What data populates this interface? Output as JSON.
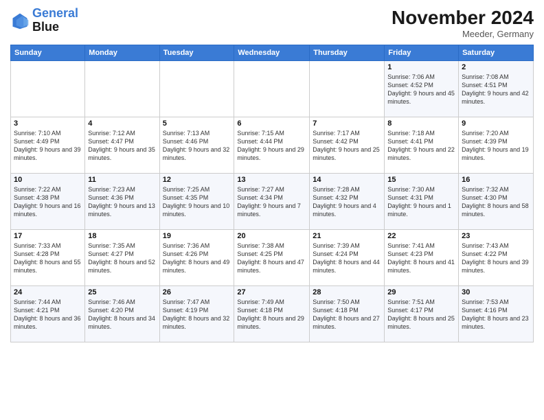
{
  "logo": {
    "line1": "General",
    "line2": "Blue"
  },
  "title": "November 2024",
  "location": "Meeder, Germany",
  "days_header": [
    "Sunday",
    "Monday",
    "Tuesday",
    "Wednesday",
    "Thursday",
    "Friday",
    "Saturday"
  ],
  "weeks": [
    [
      {
        "day": "",
        "sunrise": "",
        "sunset": "",
        "daylight": ""
      },
      {
        "day": "",
        "sunrise": "",
        "sunset": "",
        "daylight": ""
      },
      {
        "day": "",
        "sunrise": "",
        "sunset": "",
        "daylight": ""
      },
      {
        "day": "",
        "sunrise": "",
        "sunset": "",
        "daylight": ""
      },
      {
        "day": "",
        "sunrise": "",
        "sunset": "",
        "daylight": ""
      },
      {
        "day": "1",
        "sunrise": "Sunrise: 7:06 AM",
        "sunset": "Sunset: 4:52 PM",
        "daylight": "Daylight: 9 hours and 45 minutes."
      },
      {
        "day": "2",
        "sunrise": "Sunrise: 7:08 AM",
        "sunset": "Sunset: 4:51 PM",
        "daylight": "Daylight: 9 hours and 42 minutes."
      }
    ],
    [
      {
        "day": "3",
        "sunrise": "Sunrise: 7:10 AM",
        "sunset": "Sunset: 4:49 PM",
        "daylight": "Daylight: 9 hours and 39 minutes."
      },
      {
        "day": "4",
        "sunrise": "Sunrise: 7:12 AM",
        "sunset": "Sunset: 4:47 PM",
        "daylight": "Daylight: 9 hours and 35 minutes."
      },
      {
        "day": "5",
        "sunrise": "Sunrise: 7:13 AM",
        "sunset": "Sunset: 4:46 PM",
        "daylight": "Daylight: 9 hours and 32 minutes."
      },
      {
        "day": "6",
        "sunrise": "Sunrise: 7:15 AM",
        "sunset": "Sunset: 4:44 PM",
        "daylight": "Daylight: 9 hours and 29 minutes."
      },
      {
        "day": "7",
        "sunrise": "Sunrise: 7:17 AM",
        "sunset": "Sunset: 4:42 PM",
        "daylight": "Daylight: 9 hours and 25 minutes."
      },
      {
        "day": "8",
        "sunrise": "Sunrise: 7:18 AM",
        "sunset": "Sunset: 4:41 PM",
        "daylight": "Daylight: 9 hours and 22 minutes."
      },
      {
        "day": "9",
        "sunrise": "Sunrise: 7:20 AM",
        "sunset": "Sunset: 4:39 PM",
        "daylight": "Daylight: 9 hours and 19 minutes."
      }
    ],
    [
      {
        "day": "10",
        "sunrise": "Sunrise: 7:22 AM",
        "sunset": "Sunset: 4:38 PM",
        "daylight": "Daylight: 9 hours and 16 minutes."
      },
      {
        "day": "11",
        "sunrise": "Sunrise: 7:23 AM",
        "sunset": "Sunset: 4:36 PM",
        "daylight": "Daylight: 9 hours and 13 minutes."
      },
      {
        "day": "12",
        "sunrise": "Sunrise: 7:25 AM",
        "sunset": "Sunset: 4:35 PM",
        "daylight": "Daylight: 9 hours and 10 minutes."
      },
      {
        "day": "13",
        "sunrise": "Sunrise: 7:27 AM",
        "sunset": "Sunset: 4:34 PM",
        "daylight": "Daylight: 9 hours and 7 minutes."
      },
      {
        "day": "14",
        "sunrise": "Sunrise: 7:28 AM",
        "sunset": "Sunset: 4:32 PM",
        "daylight": "Daylight: 9 hours and 4 minutes."
      },
      {
        "day": "15",
        "sunrise": "Sunrise: 7:30 AM",
        "sunset": "Sunset: 4:31 PM",
        "daylight": "Daylight: 9 hours and 1 minute."
      },
      {
        "day": "16",
        "sunrise": "Sunrise: 7:32 AM",
        "sunset": "Sunset: 4:30 PM",
        "daylight": "Daylight: 8 hours and 58 minutes."
      }
    ],
    [
      {
        "day": "17",
        "sunrise": "Sunrise: 7:33 AM",
        "sunset": "Sunset: 4:28 PM",
        "daylight": "Daylight: 8 hours and 55 minutes."
      },
      {
        "day": "18",
        "sunrise": "Sunrise: 7:35 AM",
        "sunset": "Sunset: 4:27 PM",
        "daylight": "Daylight: 8 hours and 52 minutes."
      },
      {
        "day": "19",
        "sunrise": "Sunrise: 7:36 AM",
        "sunset": "Sunset: 4:26 PM",
        "daylight": "Daylight: 8 hours and 49 minutes."
      },
      {
        "day": "20",
        "sunrise": "Sunrise: 7:38 AM",
        "sunset": "Sunset: 4:25 PM",
        "daylight": "Daylight: 8 hours and 47 minutes."
      },
      {
        "day": "21",
        "sunrise": "Sunrise: 7:39 AM",
        "sunset": "Sunset: 4:24 PM",
        "daylight": "Daylight: 8 hours and 44 minutes."
      },
      {
        "day": "22",
        "sunrise": "Sunrise: 7:41 AM",
        "sunset": "Sunset: 4:23 PM",
        "daylight": "Daylight: 8 hours and 41 minutes."
      },
      {
        "day": "23",
        "sunrise": "Sunrise: 7:43 AM",
        "sunset": "Sunset: 4:22 PM",
        "daylight": "Daylight: 8 hours and 39 minutes."
      }
    ],
    [
      {
        "day": "24",
        "sunrise": "Sunrise: 7:44 AM",
        "sunset": "Sunset: 4:21 PM",
        "daylight": "Daylight: 8 hours and 36 minutes."
      },
      {
        "day": "25",
        "sunrise": "Sunrise: 7:46 AM",
        "sunset": "Sunset: 4:20 PM",
        "daylight": "Daylight: 8 hours and 34 minutes."
      },
      {
        "day": "26",
        "sunrise": "Sunrise: 7:47 AM",
        "sunset": "Sunset: 4:19 PM",
        "daylight": "Daylight: 8 hours and 32 minutes."
      },
      {
        "day": "27",
        "sunrise": "Sunrise: 7:49 AM",
        "sunset": "Sunset: 4:18 PM",
        "daylight": "Daylight: 8 hours and 29 minutes."
      },
      {
        "day": "28",
        "sunrise": "Sunrise: 7:50 AM",
        "sunset": "Sunset: 4:18 PM",
        "daylight": "Daylight: 8 hours and 27 minutes."
      },
      {
        "day": "29",
        "sunrise": "Sunrise: 7:51 AM",
        "sunset": "Sunset: 4:17 PM",
        "daylight": "Daylight: 8 hours and 25 minutes."
      },
      {
        "day": "30",
        "sunrise": "Sunrise: 7:53 AM",
        "sunset": "Sunset: 4:16 PM",
        "daylight": "Daylight: 8 hours and 23 minutes."
      }
    ]
  ]
}
